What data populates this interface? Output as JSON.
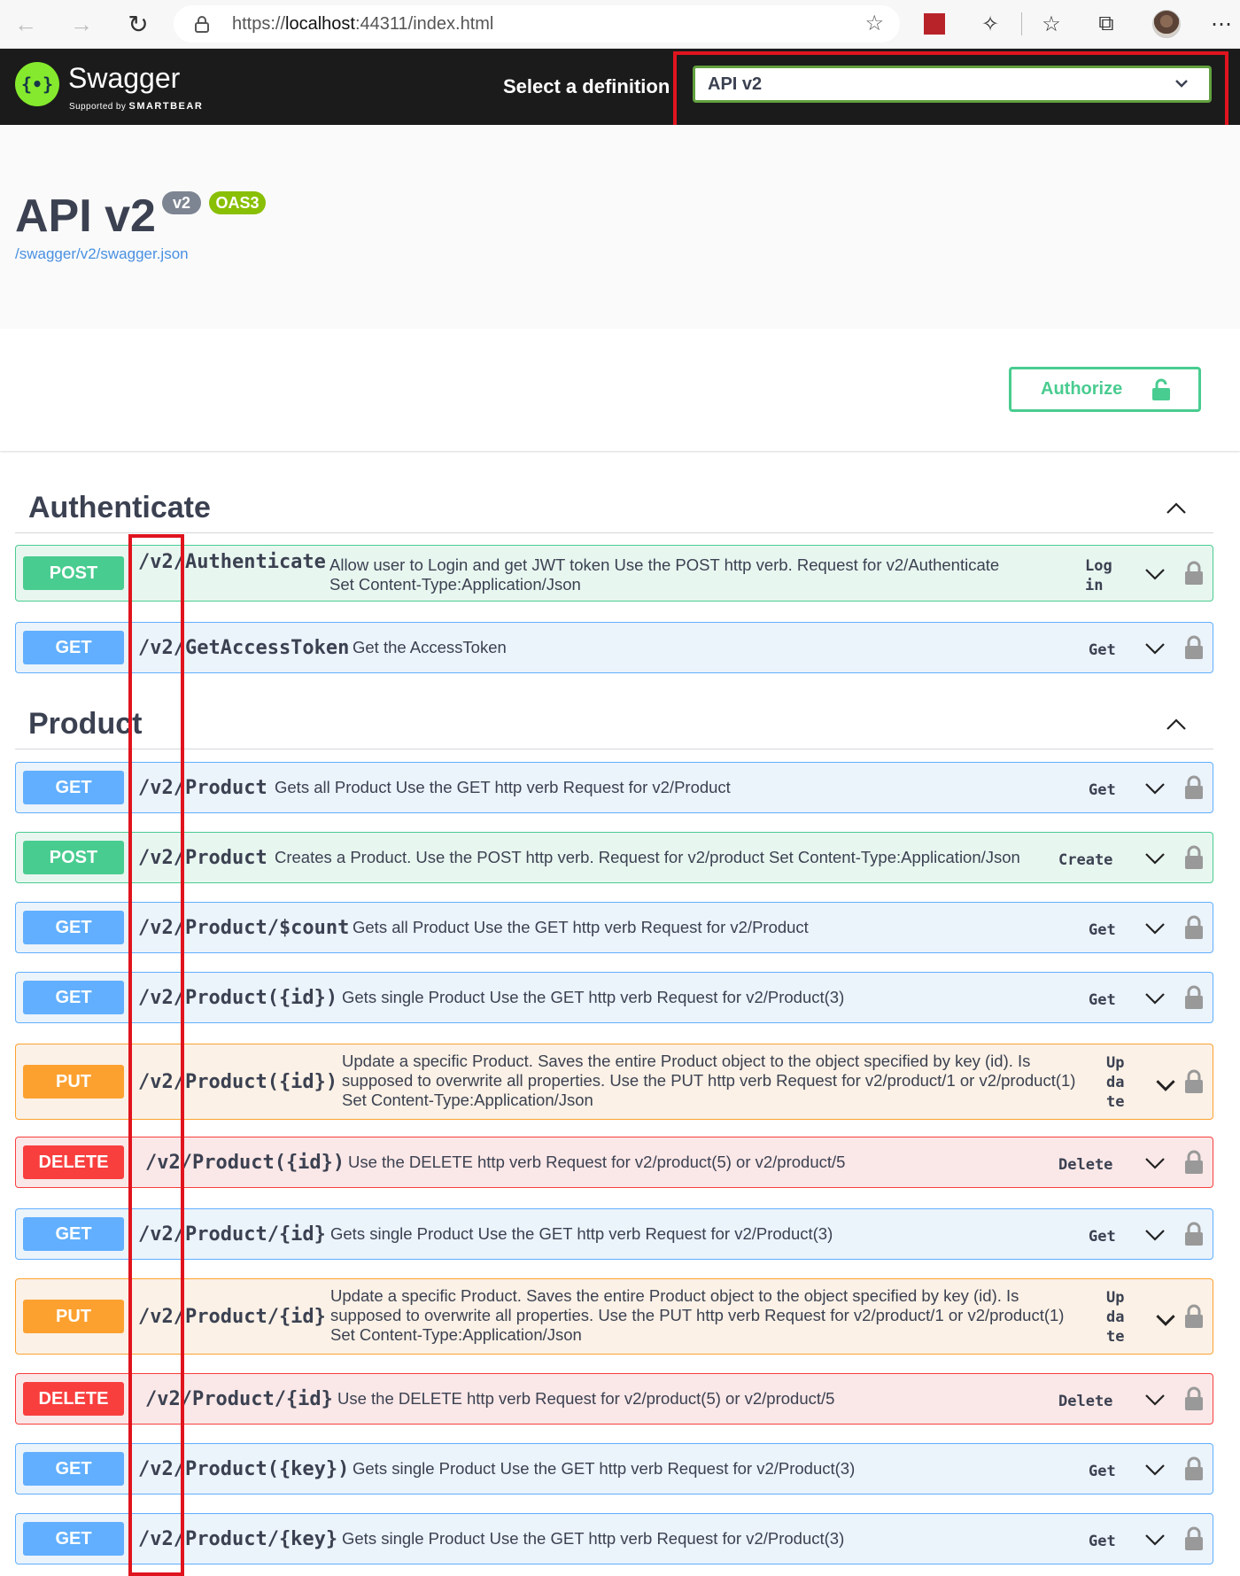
{
  "browser": {
    "url_prefix": "https://",
    "url_host": "localhost",
    "url_rest": ":44311/index.html",
    "icons": [
      "back-icon",
      "forward-icon",
      "reload-icon",
      "lock-icon",
      "add-favorite-icon",
      "extension-red-icon",
      "puzzle-icon",
      "favorites-icon",
      "collections-icon",
      "avatar",
      "more-icon"
    ]
  },
  "topbar": {
    "logo_text": "Swagger",
    "logo_sub_prefix": "Supported by",
    "logo_sub_brand": "SMARTBEAR",
    "select_label": "Select a definition",
    "selected_definition": "API v2"
  },
  "info": {
    "title": "API v2",
    "version_badge": "v2",
    "oas_badge": "OAS3",
    "spec_link": "/swagger/v2/swagger.json"
  },
  "authorize": {
    "label": "Authorize"
  },
  "colors": {
    "get": "#61affe",
    "post": "#49cc90",
    "put": "#fca130",
    "delete": "#f93e3e",
    "highlight": "#e0141e",
    "topbar": "#1b1b1b",
    "logo": "#85ea2d"
  },
  "tags": [
    {
      "name": "Authenticate",
      "operations": [
        {
          "method": "POST",
          "path": "/v2/Authenticate",
          "description": "Allow user to Login and get JWT token Use the POST http verb. Request for v2/Authenticate Set Content-Type:Application/Json",
          "operation_id": "Log in"
        },
        {
          "method": "GET",
          "path": "/v2/GetAccessToken",
          "description": "Get the AccessToken",
          "operation_id": "Get"
        }
      ]
    },
    {
      "name": "Product",
      "operations": [
        {
          "method": "GET",
          "path": "/v2/Product",
          "description": "Gets all Product Use the GET http verb Request for v2/Product",
          "operation_id": "Get"
        },
        {
          "method": "POST",
          "path": "/v2/Product",
          "description": "Creates a Product. Use the POST http verb. Request for v2/product Set Content-Type:Application/Json",
          "operation_id": "Create"
        },
        {
          "method": "GET",
          "path": "/v2/Product/$count",
          "description": "Gets all Product Use the GET http verb Request for v2/Product",
          "operation_id": "Get"
        },
        {
          "method": "GET",
          "path": "/v2/Product({id})",
          "description": "Gets single Product Use the GET http verb Request for v2/Product(3)",
          "operation_id": "Get"
        },
        {
          "method": "PUT",
          "path": "/v2/Product({id})",
          "description": "Update a specific Product. Saves the entire Product object to the object specified by key (id). Is supposed to overwrite all properties. Use the PUT http verb Request for v2/product/1 or v2/product(1) Set Content-Type:Application/Json",
          "operation_id": "Update"
        },
        {
          "method": "DELETE",
          "path": "/v2/Product({id})",
          "description": "Use the DELETE http verb Request for v2/product(5) or v2/product/5",
          "operation_id": "Delete"
        },
        {
          "method": "GET",
          "path": "/v2/Product/{id}",
          "description": "Gets single Product Use the GET http verb Request for v2/Product(3)",
          "operation_id": "Get"
        },
        {
          "method": "PUT",
          "path": "/v2/Product/{id}",
          "description": "Update a specific Product. Saves the entire Product object to the object specified by key (id). Is supposed to overwrite all properties. Use the PUT http verb Request for v2/product/1 or v2/product(1) Set Content-Type:Application/Json",
          "operation_id": "Update"
        },
        {
          "method": "DELETE",
          "path": "/v2/Product/{id}",
          "description": "Use the DELETE http verb Request for v2/product(5) or v2/product/5",
          "operation_id": "Delete"
        },
        {
          "method": "GET",
          "path": "/v2/Product({key})",
          "description": "Gets single Product Use the GET http verb Request for v2/Product(3)",
          "operation_id": "Get"
        },
        {
          "method": "GET",
          "path": "/v2/Product/{key}",
          "description": "Gets single Product Use the GET http verb Request for v2/Product(3)",
          "operation_id": "Get"
        }
      ]
    }
  ]
}
